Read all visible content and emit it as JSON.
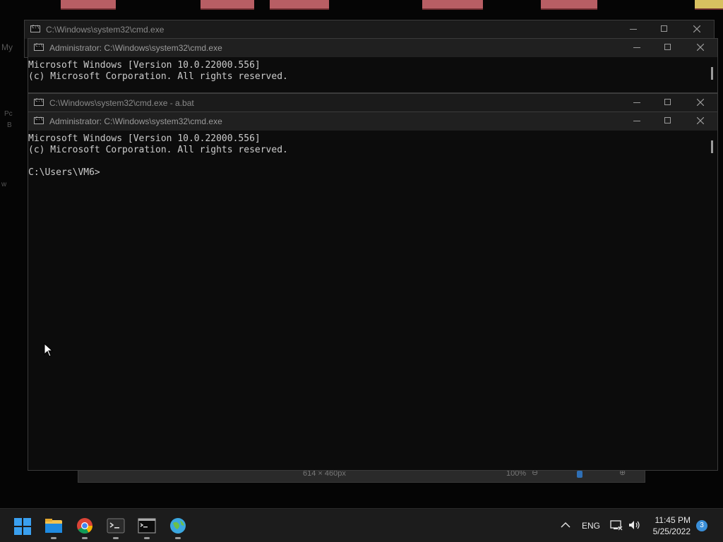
{
  "desktop": {
    "label_top_left": "My",
    "label_pc": "Pc",
    "label_b": "B",
    "label_w": "w"
  },
  "viewer": {
    "dimensions": "614 × 460px",
    "zoom": "100%"
  },
  "windows": [
    {
      "title": "C:\\Windows\\system32\\cmd.exe",
      "lines": []
    },
    {
      "title": "Administrator: C:\\Windows\\system32\\cmd.exe",
      "lines": [
        "Microsoft Windows [Version 10.0.22000.556]",
        "(c) Microsoft Corporation. All rights reserved."
      ]
    },
    {
      "title": "C:\\Windows\\system32\\cmd.exe - a.bat",
      "lines": []
    },
    {
      "title": "Administrator: C:\\Windows\\system32\\cmd.exe",
      "lines": [
        "Microsoft Windows [Version 10.0.22000.556]",
        "(c) Microsoft Corporation. All rights reserved.",
        "",
        "C:\\Users\\VM6>"
      ]
    }
  ],
  "taskbar": {
    "apps": [
      "start-icon",
      "file-explorer-icon",
      "chrome-icon",
      "terminal-icon",
      "cmd-icon",
      "network-globe-icon"
    ],
    "language": "ENG",
    "time": "11:45 PM",
    "date": "5/25/2022",
    "notification_count": "3"
  },
  "colors": {
    "console_bg": "#0c0c0c",
    "console_text": "#cccccc",
    "titlebar": "#202020",
    "taskbar": "#1c1c1c",
    "accent": "#3a8fd9"
  }
}
